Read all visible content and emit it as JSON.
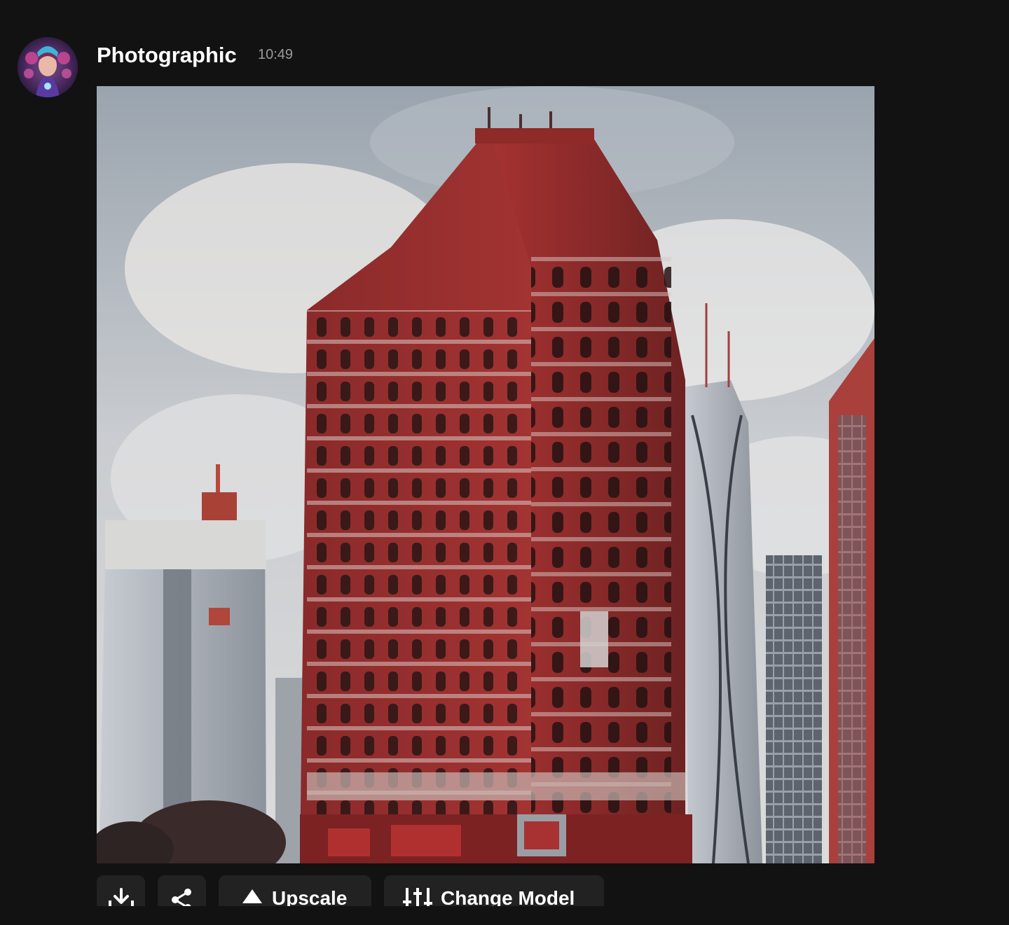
{
  "message": {
    "author": "Photographic",
    "time": "10:49",
    "image_alt": "Generated image: ornate red historic building among modern skyscrapers under a cloudy sky"
  },
  "actions": {
    "download_icon": "download-icon",
    "share_icon": "share-icon",
    "upscale_icon": "triangle-up-icon",
    "upscale_label": "Upscale",
    "model_icon": "sliders-icon",
    "model_label": "Change Model"
  },
  "colors": {
    "background": "#121212",
    "button": "#222222",
    "text": "#ffffff",
    "muted": "#9a9a9a"
  }
}
